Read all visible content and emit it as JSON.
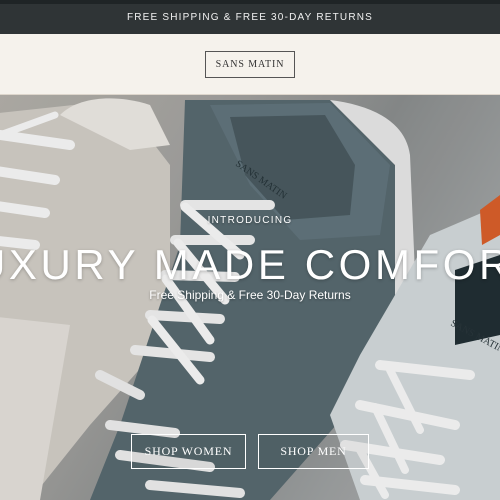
{
  "announcement": {
    "text": "FREE SHIPPING & FREE 30-DAY RETURNS"
  },
  "header": {
    "logo": "SANS MATIN"
  },
  "hero": {
    "kicker": "INTRODUCING",
    "headline": "LUXURY MADE COMFORTABLE",
    "subheadline": "Free Shipping & Free 30-Day Returns",
    "shoe_brand_marks": [
      "SANS MATIN",
      "SANS MATIN"
    ]
  },
  "cta": {
    "women": "SHOP WOMEN",
    "men": "SHOP MEN"
  },
  "colors": {
    "announcement_bg": "#2f3436",
    "header_bg": "#f5f2ec",
    "hero_bg": "#a9a8a5",
    "shoe_teal": "#5b6d73",
    "accent_orange": "#e0622c"
  }
}
